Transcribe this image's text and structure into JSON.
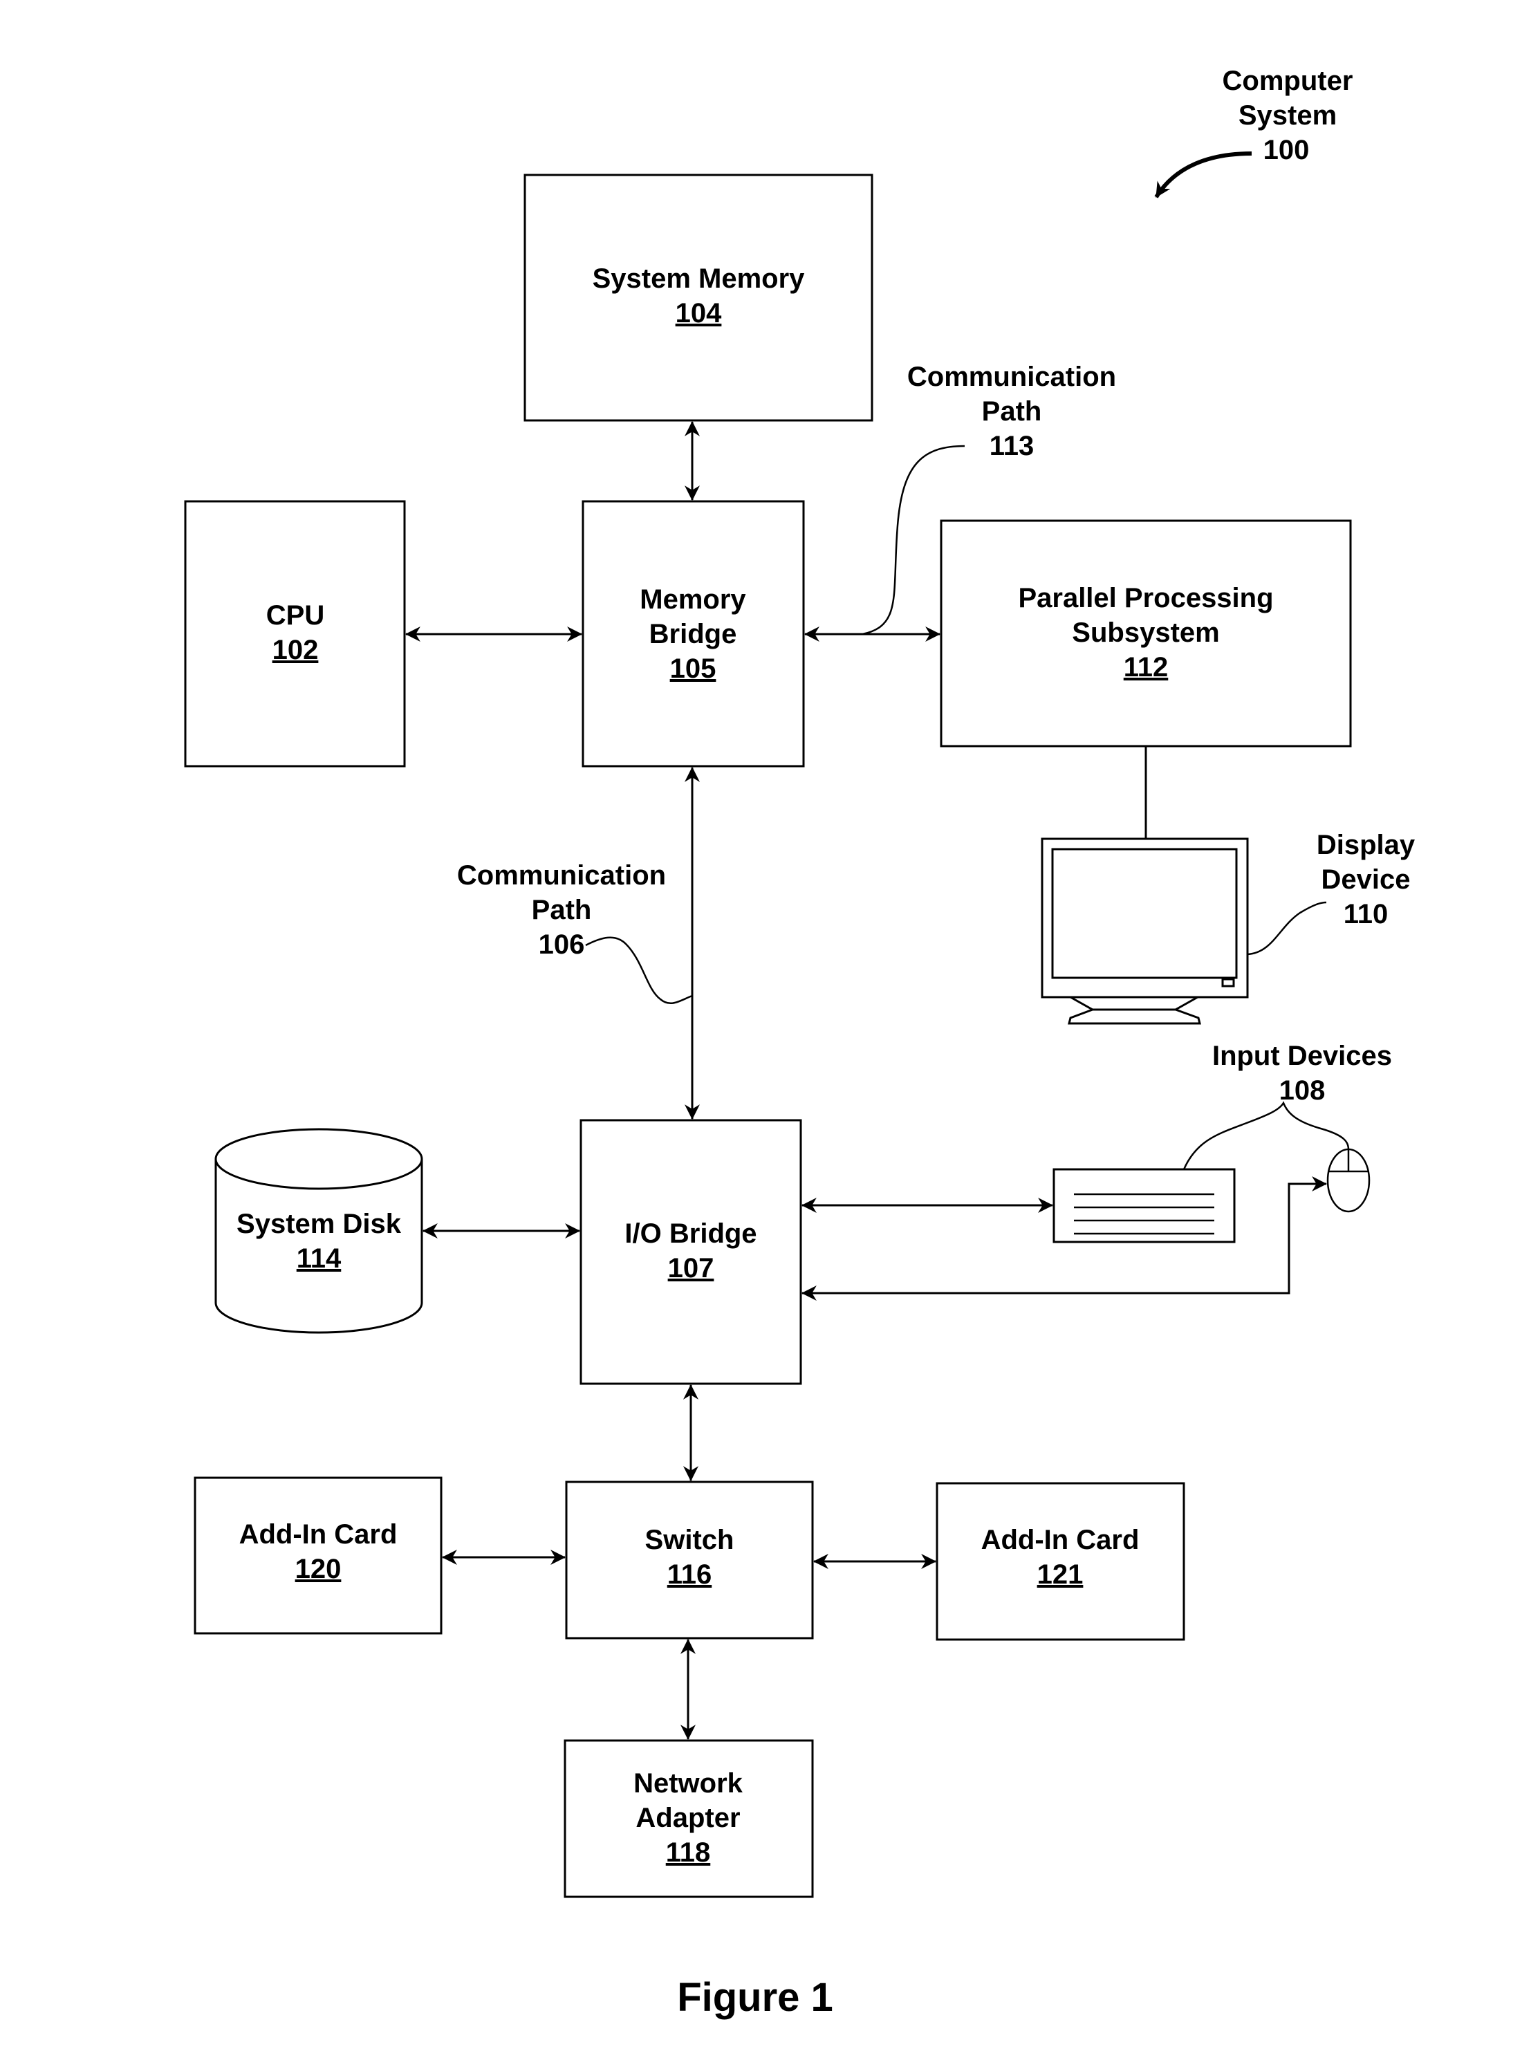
{
  "figure": {
    "caption": "Figure 1",
    "system_label": {
      "line1": "Computer",
      "line2": "System",
      "ref": "100"
    }
  },
  "blocks": {
    "system_memory": {
      "line1": "System Memory",
      "ref": "104"
    },
    "cpu": {
      "line1": "CPU",
      "ref": "102"
    },
    "memory_bridge": {
      "line1": "Memory",
      "line2": "Bridge",
      "ref": "105"
    },
    "parallel_processing": {
      "line1": "Parallel Processing",
      "line2": "Subsystem",
      "ref": "112"
    },
    "io_bridge": {
      "line1": "I/O Bridge",
      "ref": "107"
    },
    "system_disk": {
      "line1": "System Disk",
      "ref": "114"
    },
    "add_in_card_120": {
      "line1": "Add-In Card",
      "ref": "120"
    },
    "switch": {
      "line1": "Switch",
      "ref": "116"
    },
    "add_in_card_121": {
      "line1": "Add-In Card",
      "ref": "121"
    },
    "network_adapter": {
      "line1": "Network",
      "line2": "Adapter",
      "ref": "118"
    }
  },
  "callouts": {
    "comm_path_113": {
      "line1": "Communication",
      "line2": "Path",
      "ref": "113"
    },
    "comm_path_106": {
      "line1": "Communication",
      "line2": "Path",
      "ref": "106"
    },
    "display_device": {
      "line1": "Display",
      "line2": "Device",
      "ref": "110"
    },
    "input_devices": {
      "line1": "Input Devices",
      "ref": "108"
    }
  },
  "connections": [
    {
      "from": "System Memory 104",
      "to": "Memory Bridge 105",
      "type": "bidirectional"
    },
    {
      "from": "CPU 102",
      "to": "Memory Bridge 105",
      "type": "bidirectional"
    },
    {
      "from": "Memory Bridge 105",
      "to": "Parallel Processing Subsystem 112",
      "type": "bidirectional",
      "via": "Communication Path 113"
    },
    {
      "from": "Parallel Processing Subsystem 112",
      "to": "Display Device 110",
      "type": "line"
    },
    {
      "from": "Memory Bridge 105",
      "to": "I/O Bridge 107",
      "type": "bidirectional",
      "via": "Communication Path 106"
    },
    {
      "from": "System Disk 114",
      "to": "I/O Bridge 107",
      "type": "bidirectional"
    },
    {
      "from": "I/O Bridge 107",
      "to": "Keyboard (Input Devices 108)",
      "type": "bidirectional"
    },
    {
      "from": "Mouse (Input Devices 108)",
      "to": "I/O Bridge 107",
      "type": "bidirectional"
    },
    {
      "from": "I/O Bridge 107",
      "to": "Switch 116",
      "type": "bidirectional"
    },
    {
      "from": "Add-In Card 120",
      "to": "Switch 116",
      "type": "bidirectional"
    },
    {
      "from": "Switch 116",
      "to": "Add-In Card 121",
      "type": "bidirectional"
    },
    {
      "from": "Switch 116",
      "to": "Network Adapter 118",
      "type": "bidirectional"
    }
  ]
}
